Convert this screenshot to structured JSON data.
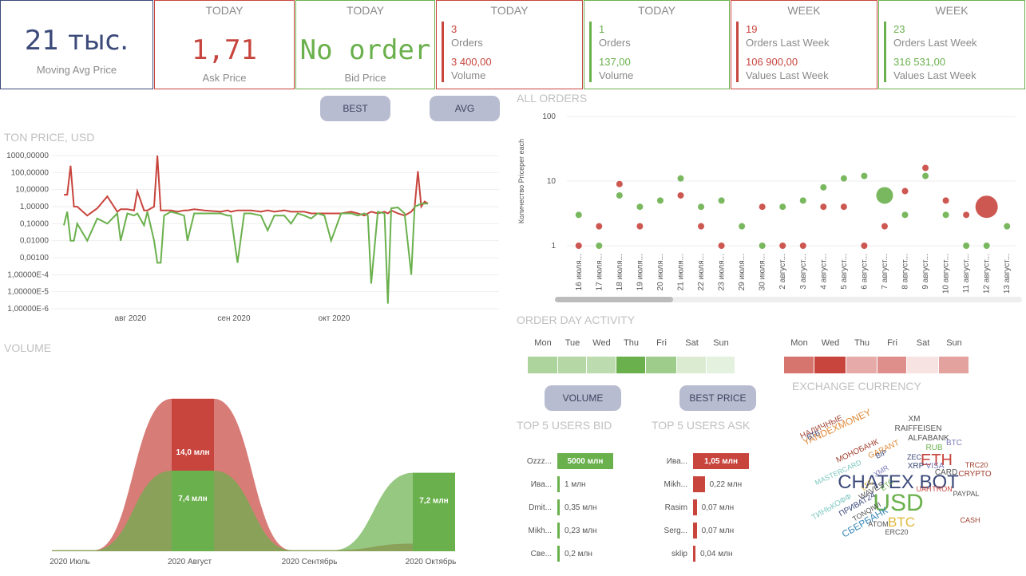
{
  "kpis": {
    "moving_avg": {
      "value": "21 тыс.",
      "label": "Moving Avg Price"
    },
    "ask": {
      "head": "TODAY",
      "value": "1,71",
      "label": "Ask Price"
    },
    "bid": {
      "head": "TODAY",
      "value": "No order",
      "label": "Bid Price"
    },
    "today_red": {
      "head": "TODAY",
      "n1": "3",
      "l1": "Orders",
      "n2": "3 400,00",
      "l2": "Volume"
    },
    "today_green": {
      "head": "TODAY",
      "n1": "1",
      "l1": "Orders",
      "n2": "137,00",
      "l2": "Volume"
    },
    "week_red": {
      "head": "WEEK",
      "n1": "19",
      "l1": "Orders Last Week",
      "n2": "106 900,00",
      "l2": "Values Last Week"
    },
    "week_green": {
      "head": "WEEK",
      "n1": "23",
      "l1": "Orders Last Week",
      "n2": "316 531,00",
      "l2": "Values Last Week"
    }
  },
  "buttons": {
    "best": "BEST",
    "avg": "AVG",
    "volume": "VOLUME",
    "best_price": "BEST PRICE"
  },
  "sections": {
    "ton_price": "TON PRICE, USD",
    "volume": "VOLUME",
    "all_orders": "ALL ORDERS",
    "order_day_activity": "ORDER DAY ACTIVITY",
    "exchange_currency": "EXCHANGE CURRENCY",
    "top5_bid": "TOP 5 USERS BID",
    "top5_ask": "TOP 5 USERS ASK"
  },
  "colors": {
    "red": "#c8453e",
    "green": "#6ab04c",
    "navy": "#3c4a7a",
    "button": "#b8bcd0"
  },
  "chart_data": [
    {
      "type": "line",
      "name": "ton_price",
      "y_scale": "log",
      "y_ticks": [
        "1000,00000",
        "100,00000",
        "10,00000",
        "1,00000",
        "0,10000",
        "0,01000",
        "0,00100",
        "1,00000E-4",
        "1,00000E-5",
        "1,00000E-6"
      ],
      "x_ticks": [
        "авг 2020",
        "сен 2020",
        "окт 2020"
      ],
      "x": [
        "2020-07-14",
        "2020-07-15",
        "2020-07-16",
        "2020-07-17",
        "2020-07-18",
        "2020-07-21",
        "2020-07-24",
        "2020-07-27",
        "2020-07-30",
        "2020-07-31",
        "2020-08-02",
        "2020-08-04",
        "2020-08-05",
        "2020-08-07",
        "2020-08-08",
        "2020-08-10",
        "2020-08-11",
        "2020-08-12",
        "2020-08-13",
        "2020-08-15",
        "2020-08-17",
        "2020-08-19",
        "2020-08-20",
        "2020-08-22",
        "2020-08-25",
        "2020-08-30",
        "2020-09-01",
        "2020-09-02",
        "2020-09-04",
        "2020-09-06",
        "2020-09-08",
        "2020-09-11",
        "2020-09-13",
        "2020-09-15",
        "2020-09-18",
        "2020-09-20",
        "2020-09-22",
        "2020-09-24",
        "2020-09-26",
        "2020-09-28",
        "2020-09-30",
        "2020-10-02",
        "2020-10-05",
        "2020-10-08",
        "2020-10-10",
        "2020-10-12",
        "2020-10-13",
        "2020-10-14",
        "2020-10-16",
        "2020-10-18",
        "2020-10-19",
        "2020-10-20",
        "2020-10-22",
        "2020-10-24",
        "2020-10-26",
        "2020-10-27",
        "2020-10-28",
        "2020-10-29",
        "2020-10-30",
        "2020-10-31"
      ],
      "series": [
        {
          "color": "#c8453e",
          "values": [
            5,
            5,
            250,
            1,
            1,
            0.3,
            0.8,
            4,
            0.5,
            0.7,
            0.7,
            0.6,
            8,
            0.6,
            0.6,
            1,
            1000,
            0.6,
            0.6,
            0.6,
            0.5,
            0.6,
            0.6,
            0.7,
            0.6,
            0.5,
            0.6,
            0.5,
            0.6,
            0.6,
            0.6,
            0.5,
            0.6,
            0.5,
            0.6,
            0.5,
            0.5,
            0.5,
            0.4,
            0.4,
            0.4,
            0.4,
            0.4,
            0.5,
            0.4,
            0.3,
            0.4,
            0.5,
            0.4,
            0.5,
            0.4,
            0.6,
            0.4,
            0.3,
            0.5,
            0.9,
            120,
            1,
            2,
            1.5
          ]
        },
        {
          "color": "#6ab04c",
          "values": [
            0.08,
            0.5,
            0.01,
            0.01,
            0.1,
            0.01,
            0.2,
            0.1,
            0.4,
            0.01,
            0.4,
            0.3,
            0.4,
            0.08,
            0.5,
            0.01,
            0.0005,
            0.0005,
            0.3,
            0.5,
            0.4,
            0.3,
            0.01,
            0.4,
            0.4,
            0.4,
            0.3,
            0.3,
            0.0005,
            0.4,
            0.4,
            0.3,
            0.04,
            0.3,
            0.3,
            0.1,
            0.4,
            0.3,
            0.2,
            0.4,
            0.3,
            0.01,
            0.4,
            0.4,
            0.3,
            0.4,
            0.3,
            3e-05,
            0.5,
            0.4,
            2e-06,
            0.8,
            0.9,
            0.4,
            0.0001,
            1,
            1.2,
            1.5,
            1.5,
            1.5
          ]
        }
      ]
    },
    {
      "type": "scatter",
      "name": "all_orders",
      "y_scale": "log",
      "ylabel": "Количество Priceper each",
      "y_ticks": [
        "100",
        "10",
        "1"
      ],
      "categories": [
        "16 июля...",
        "17 июля...",
        "18 июля...",
        "19 июля...",
        "20 июля...",
        "21 июля...",
        "22 июля...",
        "23 июля...",
        "29 июля...",
        "30 июля...",
        "2 август...",
        "3 август...",
        "4 август...",
        "5 август...",
        "6 август...",
        "7 август...",
        "8 август...",
        "9 август...",
        "10 август...",
        "11 август...",
        "12 август...",
        "13 август..."
      ],
      "series": [
        {
          "color": "#6ab04c",
          "points": [
            [
              0,
              3,
              1
            ],
            [
              1,
              1,
              1
            ],
            [
              2,
              6,
              1
            ],
            [
              3,
              4,
              1
            ],
            [
              4,
              5,
              1
            ],
            [
              5,
              11,
              1
            ],
            [
              6,
              4,
              1
            ],
            [
              7,
              5,
              1
            ],
            [
              8,
              2,
              1
            ],
            [
              9,
              1,
              1
            ],
            [
              10,
              4,
              1
            ],
            [
              11,
              5,
              1
            ],
            [
              12,
              8,
              1
            ],
            [
              13,
              11,
              1
            ],
            [
              14,
              12,
              1
            ],
            [
              15,
              6,
              3
            ],
            [
              16,
              3,
              1
            ],
            [
              17,
              12,
              1
            ],
            [
              18,
              3,
              1
            ],
            [
              19,
              1,
              1
            ],
            [
              20,
              1,
              1
            ],
            [
              21,
              2,
              1
            ]
          ]
        },
        {
          "color": "#c8453e",
          "points": [
            [
              0,
              1,
              1
            ],
            [
              1,
              2,
              1
            ],
            [
              2,
              9,
              1
            ],
            [
              3,
              2,
              1
            ],
            [
              5,
              6,
              1
            ],
            [
              6,
              2,
              1
            ],
            [
              7,
              1,
              1
            ],
            [
              9,
              4,
              1
            ],
            [
              10,
              1,
              1
            ],
            [
              11,
              1,
              1
            ],
            [
              12,
              4,
              1
            ],
            [
              13,
              4,
              1
            ],
            [
              14,
              1,
              1
            ],
            [
              15,
              2,
              1
            ],
            [
              16,
              7,
              1
            ],
            [
              17,
              16,
              1
            ],
            [
              18,
              5,
              1
            ],
            [
              19,
              3,
              1
            ],
            [
              20,
              4,
              4
            ]
          ]
        }
      ]
    },
    {
      "type": "area",
      "name": "volume",
      "categories": [
        "2020 Июль",
        "2020 Август",
        "2020 Сентябрь",
        "2020 Октябрь"
      ],
      "series": [
        {
          "color": "#c8453e",
          "values": [
            0.1,
            14.0,
            0.1,
            0.7
          ],
          "labels": [
            "",
            "14,0 млн",
            "",
            ""
          ]
        },
        {
          "color": "#6ab04c",
          "values": [
            0.1,
            7.4,
            0.1,
            7.2
          ],
          "labels": [
            "",
            "7,4 млн",
            "",
            "7,2 млн"
          ]
        }
      ],
      "ylim": [
        0,
        14.5
      ]
    },
    {
      "type": "heatmap",
      "name": "day_activity_bid",
      "categories": [
        "Mon",
        "Tue",
        "Wed",
        "Thu",
        "Fri",
        "Sat",
        "Sun"
      ],
      "values": [
        0.55,
        0.5,
        0.45,
        1.0,
        0.65,
        0.25,
        0.18
      ],
      "color": "#6ab04c"
    },
    {
      "type": "heatmap",
      "name": "day_activity_ask",
      "categories": [
        "Mon",
        "Wed",
        "Thu",
        "Fri",
        "Sat",
        "Sun"
      ],
      "values": [
        0.75,
        1.0,
        0.45,
        0.6,
        0.15,
        0.5
      ],
      "color": "#c8453e"
    },
    {
      "type": "bar",
      "name": "top5_bid",
      "categories": [
        "Ozzz...",
        "Ива...",
        "Dmit...",
        "Mikh...",
        "Све..."
      ],
      "values": [
        5000,
        1,
        0.35,
        0.23,
        0.2
      ],
      "labels": [
        "5000 млн",
        "1 млн",
        "0,35 млн",
        "0,23 млн",
        "0,2 млн"
      ],
      "color": "#6ab04c"
    },
    {
      "type": "bar",
      "name": "top5_ask",
      "categories": [
        "Ива...",
        "Mikh...",
        "Rasim",
        "Serg...",
        "sklip"
      ],
      "values": [
        1.05,
        0.22,
        0.07,
        0.07,
        0.04
      ],
      "labels": [
        "1,05 млн",
        "0,22 млн",
        "0,07 млн",
        "0,07 млн",
        "0,04 млн"
      ],
      "color": "#c8453e"
    }
  ],
  "word_cloud": [
    {
      "text": "CHATEX BOT",
      "color": "#3c4a7a"
    },
    {
      "text": "USD",
      "color": "#6ab04c"
    },
    {
      "text": "ETH",
      "color": "#c8453e"
    },
    {
      "text": "BTC",
      "color": "#e0b83a"
    },
    {
      "text": "YANDEXMONEY",
      "color": "#e08a3a"
    },
    {
      "text": "НАЛИЧНЫЕ",
      "color": "#a04030"
    },
    {
      "text": "ВТБ",
      "color": "#3c4a7a"
    },
    {
      "text": "МОНОБАНК",
      "color": "#a04030"
    },
    {
      "text": "GARANT",
      "color": "#e08a3a"
    },
    {
      "text": "MASTERCARD",
      "color": "#7ec8c0"
    },
    {
      "text": "BIP",
      "color": "#3c4a7a"
    },
    {
      "text": "RAIFFEISEN",
      "color": "#555555"
    },
    {
      "text": "XM",
      "color": "#555555"
    },
    {
      "text": "ALFABANK",
      "color": "#555555"
    },
    {
      "text": "BTC",
      "color": "#7a7ab8"
    },
    {
      "text": "RUB",
      "color": "#6ab04c"
    },
    {
      "text": "ZEC",
      "color": "#3c4a7a"
    },
    {
      "text": "XRP",
      "color": "#3c4a7a"
    },
    {
      "text": "VISA",
      "color": "#7a7ab8"
    },
    {
      "text": "CARD",
      "color": "#555555"
    },
    {
      "text": "TRC20",
      "color": "#a04030"
    },
    {
      "text": "CRYPTO",
      "color": "#a04030"
    },
    {
      "text": "XMR",
      "color": "#7a7ab8"
    },
    {
      "text": "LTC",
      "color": "#e0b83a"
    },
    {
      "text": "WAVES",
      "color": "#555555"
    },
    {
      "text": "ETC",
      "color": "#6ab04c"
    },
    {
      "text": "ТИНЬКОФФ",
      "color": "#7ec8c0"
    },
    {
      "text": "ПРИВАТ24",
      "color": "#3c4a7a"
    },
    {
      "text": "TONQIWI",
      "color": "#555555"
    },
    {
      "text": "UAH",
      "color": "#c8453e"
    },
    {
      "text": "TRON",
      "color": "#c8453e"
    },
    {
      "text": "PAYPAL",
      "color": "#555555"
    },
    {
      "text": "СБЕРБАНК",
      "color": "#3c8ab8"
    },
    {
      "text": "ATOM",
      "color": "#555555"
    },
    {
      "text": "ERC20",
      "color": "#555555"
    },
    {
      "text": "CASH",
      "color": "#a04030"
    }
  ]
}
